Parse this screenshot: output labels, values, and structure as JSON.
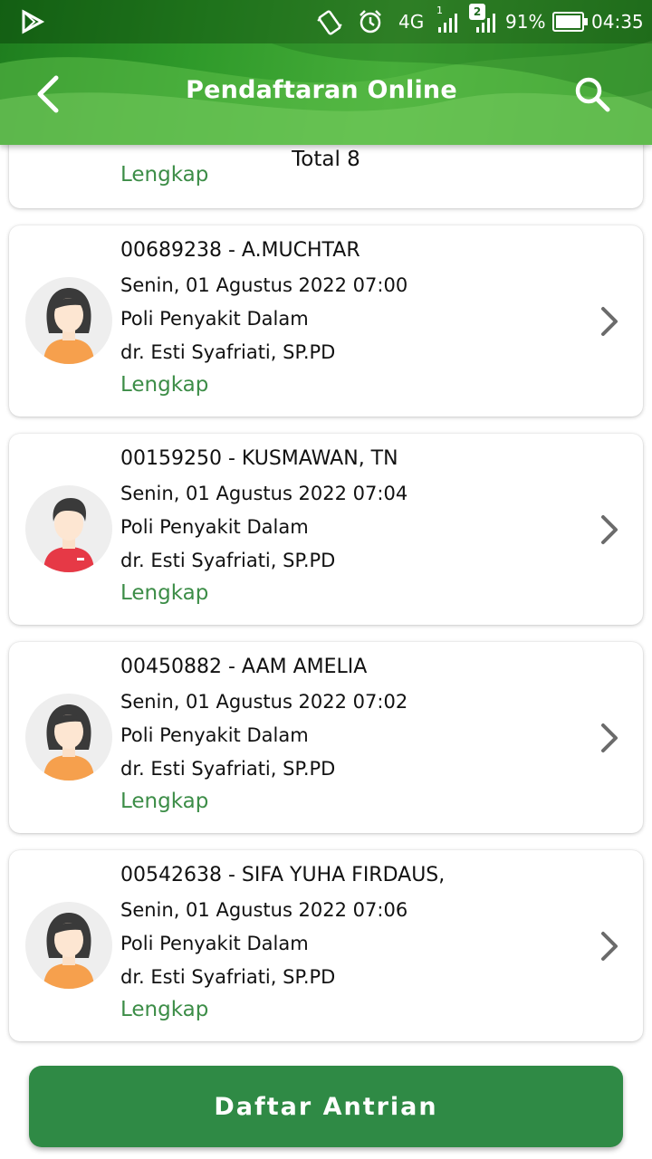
{
  "status_bar": {
    "network": "4G",
    "sim1": "1",
    "sim2": "2",
    "battery": "91%",
    "time": "04:35",
    "icons": [
      "play-store-icon",
      "vibrate-icon",
      "alarm-icon",
      "signal-icon",
      "battery-icon"
    ]
  },
  "appbar": {
    "title": "Pendaftaran Online",
    "back_icon": "back-arrow-icon",
    "search_icon": "search-icon"
  },
  "summary": {
    "total_label": "Total 8"
  },
  "partial_card": {
    "status": "Lengkap"
  },
  "registrations": [
    {
      "title": "00689238 - A.MUCHTAR",
      "datetime": "Senin, 01 Agustus 2022 07:00",
      "clinic": "Poli Penyakit Dalam",
      "doctor": "dr. Esti Syafriati,  SP.PD",
      "status": "Lengkap",
      "avatar": "female-avatar-icon"
    },
    {
      "title": "00159250 - KUSMAWAN, TN",
      "datetime": "Senin, 01 Agustus 2022 07:04",
      "clinic": "Poli Penyakit Dalam",
      "doctor": "dr. Esti Syafriati,  SP.PD",
      "status": "Lengkap",
      "avatar": "male-avatar-icon"
    },
    {
      "title": "00450882 - AAM AMELIA",
      "datetime": "Senin, 01 Agustus 2022 07:02",
      "clinic": "Poli Penyakit Dalam",
      "doctor": "dr. Esti Syafriati,  SP.PD",
      "status": "Lengkap",
      "avatar": "female-avatar-icon"
    },
    {
      "title": "00542638 - SIFA YUHA  FIRDAUS,",
      "datetime": "Senin, 01 Agustus 2022 07:06",
      "clinic": "Poli Penyakit Dalam",
      "doctor": "dr. Esti Syafriati,  SP.PD",
      "status": "Lengkap",
      "avatar": "female-avatar-icon"
    }
  ],
  "bottom_button": {
    "label": "Daftar Antrian"
  },
  "colors": {
    "header_green": "#2f9a2a",
    "status_green": "#3c8d47",
    "button_green": "#2f8a45",
    "female_shirt": "#f6a04d",
    "male_shirt": "#e63946",
    "hair": "#3a3a3a"
  }
}
